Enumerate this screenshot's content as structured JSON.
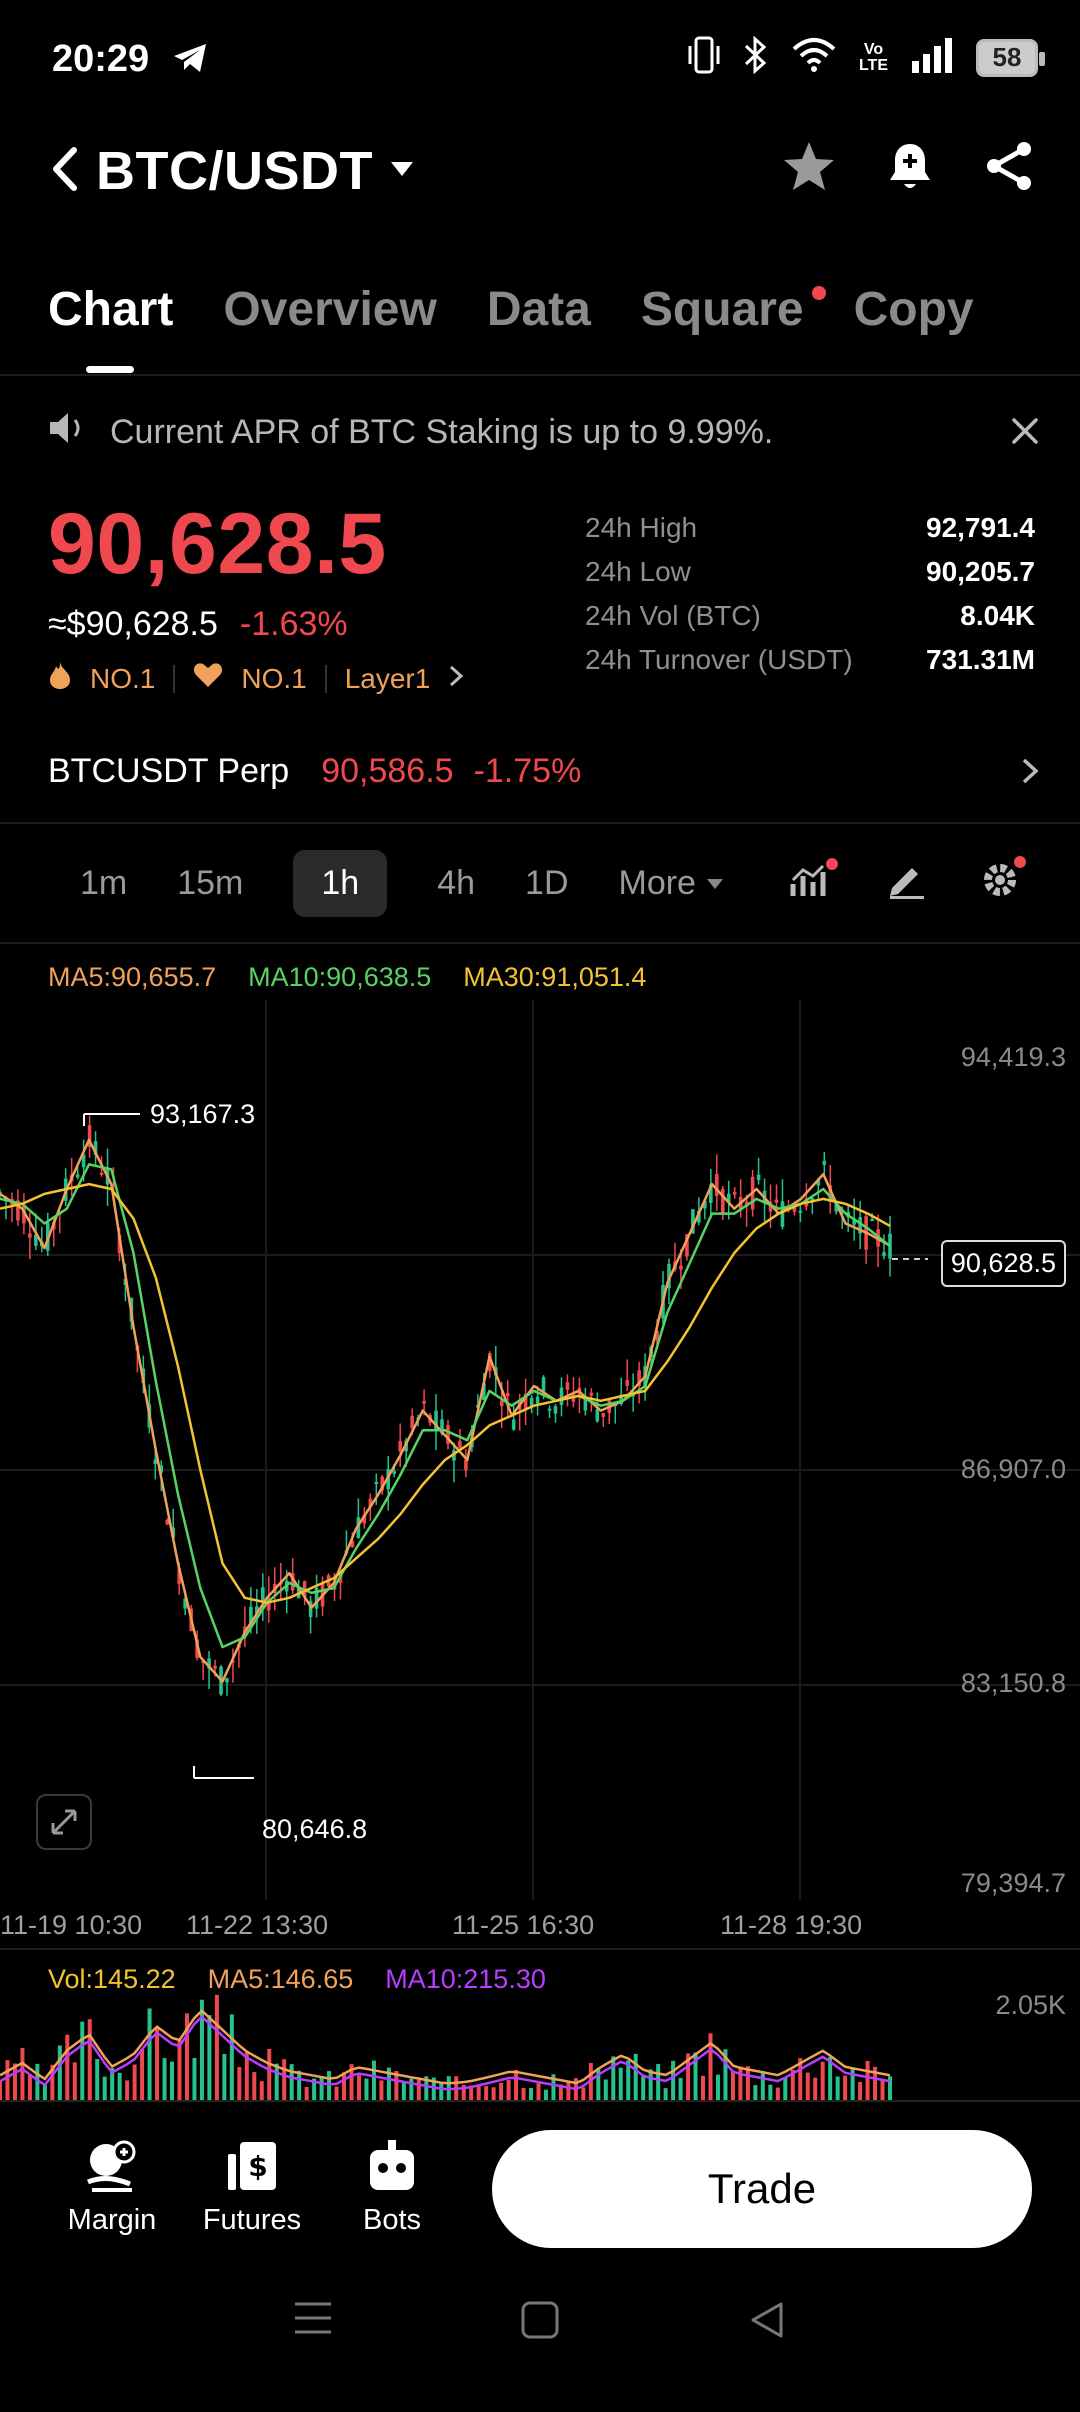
{
  "status": {
    "time": "20:29",
    "battery": "58"
  },
  "header": {
    "pair": "BTC/USDT"
  },
  "tabs": [
    {
      "label": "Chart",
      "active": true
    },
    {
      "label": "Overview"
    },
    {
      "label": "Data"
    },
    {
      "label": "Square",
      "dot": true
    },
    {
      "label": "Copy"
    }
  ],
  "announcement": {
    "text": "Current APR of BTC Staking is up to 9.99%."
  },
  "price": {
    "last": "90,628.5",
    "usd": "≈$90,628.5",
    "change": "-1.63%",
    "tags": [
      "NO.1",
      "NO.1",
      "Layer1"
    ]
  },
  "stats": [
    {
      "label": "24h High",
      "value": "92,791.4"
    },
    {
      "label": "24h Low",
      "value": "90,205.7"
    },
    {
      "label": "24h Vol (BTC)",
      "value": "8.04K"
    },
    {
      "label": "24h Turnover (USDT)",
      "value": "731.31M"
    }
  ],
  "perp": {
    "label": "BTCUSDT Perp",
    "price": "90,586.5",
    "change": "-1.75%"
  },
  "timeframes": [
    "1m",
    "15m",
    "1h",
    "4h",
    "1D"
  ],
  "timeframe_active": "1h",
  "more_label": "More",
  "ma_legend": {
    "ma5": "MA5:90,655.7",
    "ma10": "MA10:90,638.5",
    "ma30": "MA30:91,051.4"
  },
  "colors": {
    "up": "#27c28b",
    "down": "#f0484f",
    "ma5": "#f0a15a",
    "ma10": "#56d364",
    "ma30": "#f2c233",
    "vol_ma10": "#b83dff"
  },
  "chart_data": {
    "type": "line",
    "price_ticks": [
      "94,419.3",
      "86,907.0",
      "83,150.8",
      "79,394.7"
    ],
    "time_ticks": [
      "11-19 10:30",
      "11-22 13:30",
      "11-25 16:30",
      "11-28 19:30"
    ],
    "high_label": "93,167.3",
    "low_label": "80,646.8",
    "current_price": "90,628.5",
    "ylim": [
      79394.7,
      94419.3
    ],
    "series": [
      {
        "name": "MA5",
        "values": [
          91700,
          91400,
          90600,
          91800,
          92800,
          91900,
          89000,
          86500,
          84200,
          82300,
          81800,
          82800,
          83500,
          84000,
          83300,
          83800,
          84900,
          85600,
          86400,
          87300,
          86800,
          86300,
          88400,
          87200,
          87800,
          87500,
          87700,
          87300,
          87500,
          88000,
          89900,
          90900,
          91900,
          91400,
          91800,
          91300,
          91600,
          92100,
          91100,
          90900,
          90650
        ]
      },
      {
        "name": "MA10",
        "values": [
          91600,
          91500,
          91100,
          91400,
          92300,
          92200,
          90500,
          87900,
          85600,
          83700,
          82500,
          82700,
          83400,
          83800,
          83600,
          83700,
          84500,
          85200,
          86000,
          86900,
          86900,
          86700,
          87700,
          87400,
          87700,
          87500,
          87600,
          87400,
          87500,
          87800,
          89300,
          90300,
          91300,
          91300,
          91600,
          91400,
          91500,
          91800,
          91300,
          91000,
          90640
        ]
      },
      {
        "name": "MA30",
        "values": [
          91400,
          91500,
          91700,
          91800,
          91900,
          91800,
          91200,
          90000,
          88200,
          86100,
          84200,
          83500,
          83400,
          83500,
          83700,
          83900,
          84300,
          84700,
          85200,
          85800,
          86300,
          86600,
          87000,
          87200,
          87400,
          87500,
          87600,
          87500,
          87600,
          87700,
          88300,
          89000,
          89800,
          90500,
          91000,
          91300,
          91500,
          91600,
          91500,
          91300,
          91050
        ]
      }
    ]
  },
  "volume": {
    "vol": "Vol:145.22",
    "ma5": "MA5:146.65",
    "ma10": "MA10:215.30",
    "axis_max": "2.05K",
    "bars": [
      30,
      45,
      25,
      60,
      80,
      40,
      55,
      90,
      70,
      110,
      85,
      60,
      45,
      35,
      30,
      25,
      40,
      35,
      30,
      25,
      20,
      22,
      28,
      35,
      30,
      25,
      20,
      40,
      55,
      35,
      30,
      50,
      70,
      40,
      35,
      30,
      45,
      60,
      40,
      35,
      30
    ]
  },
  "bottom_nav": [
    {
      "label": "Margin"
    },
    {
      "label": "Futures"
    },
    {
      "label": "Bots"
    }
  ],
  "trade_label": "Trade"
}
